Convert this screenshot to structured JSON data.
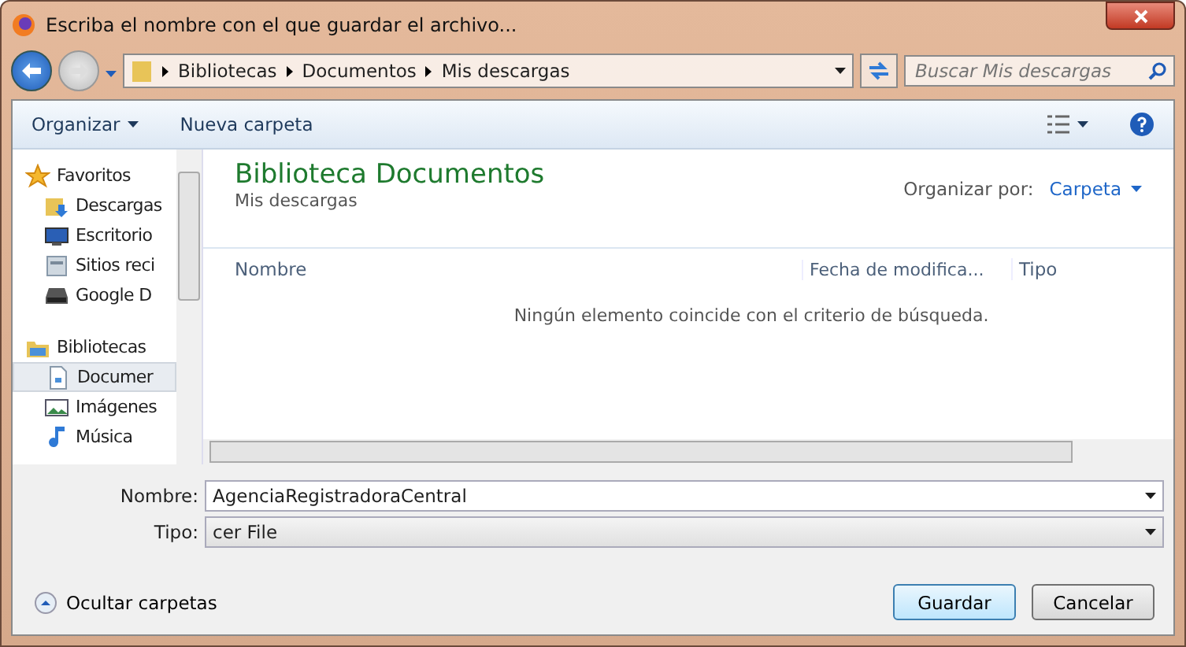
{
  "window": {
    "title": "Escriba el nombre con el que guardar el archivo..."
  },
  "breadcrumb": [
    "Bibliotecas",
    "Documentos",
    "Mis descargas"
  ],
  "search": {
    "placeholder": "Buscar Mis descargas"
  },
  "toolbar": {
    "organize": "Organizar",
    "new_folder": "Nueva carpeta"
  },
  "sidebar": {
    "items": [
      {
        "label": "Favoritos",
        "kind": "section",
        "selected": false
      },
      {
        "label": "Descargas",
        "kind": "item",
        "selected": false
      },
      {
        "label": "Escritorio",
        "kind": "item",
        "selected": false
      },
      {
        "label": "Sitios reci",
        "kind": "item",
        "selected": false
      },
      {
        "label": "Google D",
        "kind": "item",
        "selected": false
      },
      {
        "label": "Bibliotecas",
        "kind": "section",
        "selected": false
      },
      {
        "label": "Documer",
        "kind": "item",
        "selected": true
      },
      {
        "label": "Imágenes",
        "kind": "item",
        "selected": false
      },
      {
        "label": "Música",
        "kind": "item",
        "selected": false
      }
    ]
  },
  "library": {
    "title": "Biblioteca Documentos",
    "subtitle": "Mis descargas",
    "arrange_label": "Organizar por:",
    "arrange_value": "Carpeta"
  },
  "table": {
    "columns": [
      "Nombre",
      "Fecha de modifica...",
      "Tipo"
    ],
    "empty_message": "Ningún elemento coincide con el criterio de búsqueda."
  },
  "form": {
    "name_label": "Nombre:",
    "name_value": "AgenciaRegistradoraCentral",
    "type_label": "Tipo:",
    "type_value": "cer File"
  },
  "footer": {
    "hide_folders": "Ocultar carpetas",
    "save": "Guardar",
    "cancel": "Cancelar"
  }
}
